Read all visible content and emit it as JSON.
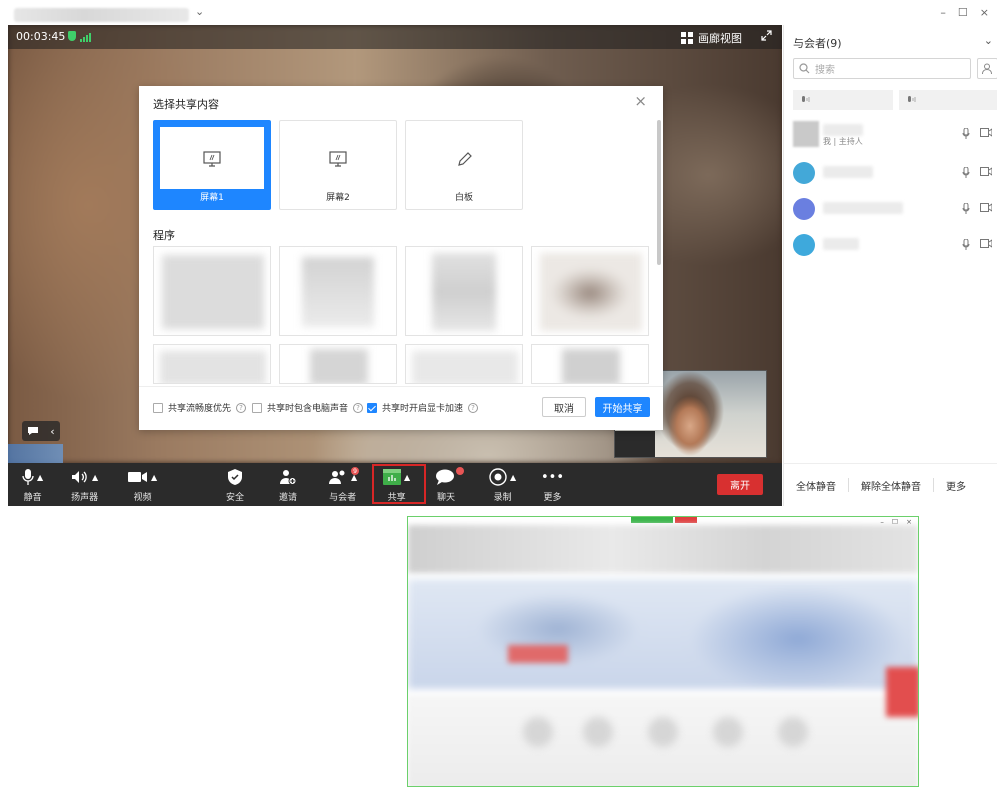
{
  "window": {
    "controls": [
      "–",
      "☐",
      "×"
    ],
    "title_chevron": "⌄"
  },
  "video": {
    "timer": "00:03:45",
    "gallery_view_label": "画廊视图",
    "chat_bubble_collapse": "‹"
  },
  "share_dialog": {
    "title": "选择共享内容",
    "close": "×",
    "screens": [
      {
        "label": "屏幕1",
        "icon": "monitor-icon",
        "selected": true
      },
      {
        "label": "屏幕2",
        "icon": "monitor-icon",
        "selected": false
      },
      {
        "label": "白板",
        "icon": "pen-icon",
        "selected": false
      }
    ],
    "programs_label": "程序",
    "options": [
      {
        "label": "共享流畅度优先",
        "checked": false
      },
      {
        "label": "共享时包含电脑声音",
        "checked": false
      },
      {
        "label": "共享时开启显卡加速",
        "checked": true
      }
    ],
    "help_glyph": "?",
    "cancel": "取消",
    "start_share": "开始共享"
  },
  "toolbar": {
    "mute": "静音",
    "speaker": "扬声器",
    "video": "视频",
    "security": "安全",
    "invite": "邀请",
    "participants": "与会者",
    "participants_badge": "9",
    "share": "共享",
    "chat": "聊天",
    "record": "录制",
    "more": "更多",
    "leave": "离开",
    "more_glyph": "•••"
  },
  "participants_panel": {
    "title": "与会者(9)",
    "search_placeholder": "搜索",
    "self_sub": "我 | 主持人",
    "avatar_colors": [
      "#c9c9c9",
      "#43a8d8",
      "#6a7fe0",
      "#3ea9dc"
    ],
    "mute_all": "全体静音",
    "unmute_all": "解除全体静音",
    "more": "更多"
  },
  "colors": {
    "accent": "#1e86ff",
    "leave": "#d83030",
    "toolbar_bg": "#2b2b2b",
    "share_highlight": "#d82626"
  }
}
